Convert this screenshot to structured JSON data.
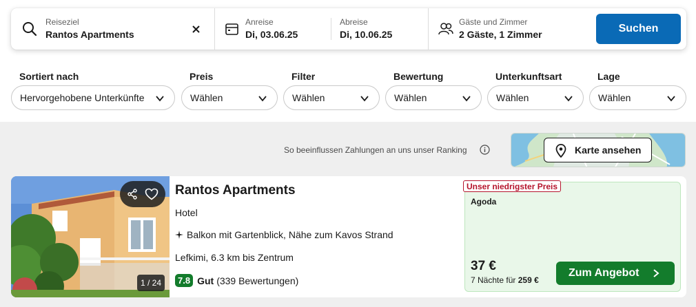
{
  "search": {
    "destination_label": "Reiseziel",
    "destination_value": "Rantos Apartments",
    "checkin_label": "Anreise",
    "checkin_value": "Di, 03.06.25",
    "checkout_label": "Abreise",
    "checkout_value": "Di, 10.06.25",
    "guests_label": "Gäste und Zimmer",
    "guests_value": "2 Gäste, 1 Zimmer",
    "search_button": "Suchen"
  },
  "filters": [
    {
      "label": "Sortiert nach",
      "value": "Hervorgehobene Unterkünfte"
    },
    {
      "label": "Preis",
      "value": "Wählen"
    },
    {
      "label": "Filter",
      "value": "Wählen"
    },
    {
      "label": "Bewertung",
      "value": "Wählen"
    },
    {
      "label": "Unterkunftsart",
      "value": "Wählen"
    },
    {
      "label": "Lage",
      "value": "Wählen"
    }
  ],
  "ranking_note": "So beeinflussen Zahlungen an uns unser Ranking",
  "map_button": "Karte ansehen",
  "listing": {
    "photo_counter": "1 / 24",
    "title": "Rantos Apartments",
    "type": "Hotel",
    "feature": "Balkon mit Gartenblick, Nähe zum Kavos Strand",
    "location": "Lefkimi, 6.3 km bis Zentrum",
    "score": "7.8",
    "rating_word": "Gut",
    "reviews": "(339 Bewertungen)",
    "deal_badge": "Unser niedrigster Preis",
    "provider": "Agoda",
    "price": "37 €",
    "price_sub_prefix": "7 Nächte für",
    "price_total": "259 €",
    "offer_button": "Zum Angebot"
  },
  "colors": {
    "accent_blue": "#0a6ab6",
    "green": "#137c2c",
    "badge_red": "#b5132b"
  }
}
